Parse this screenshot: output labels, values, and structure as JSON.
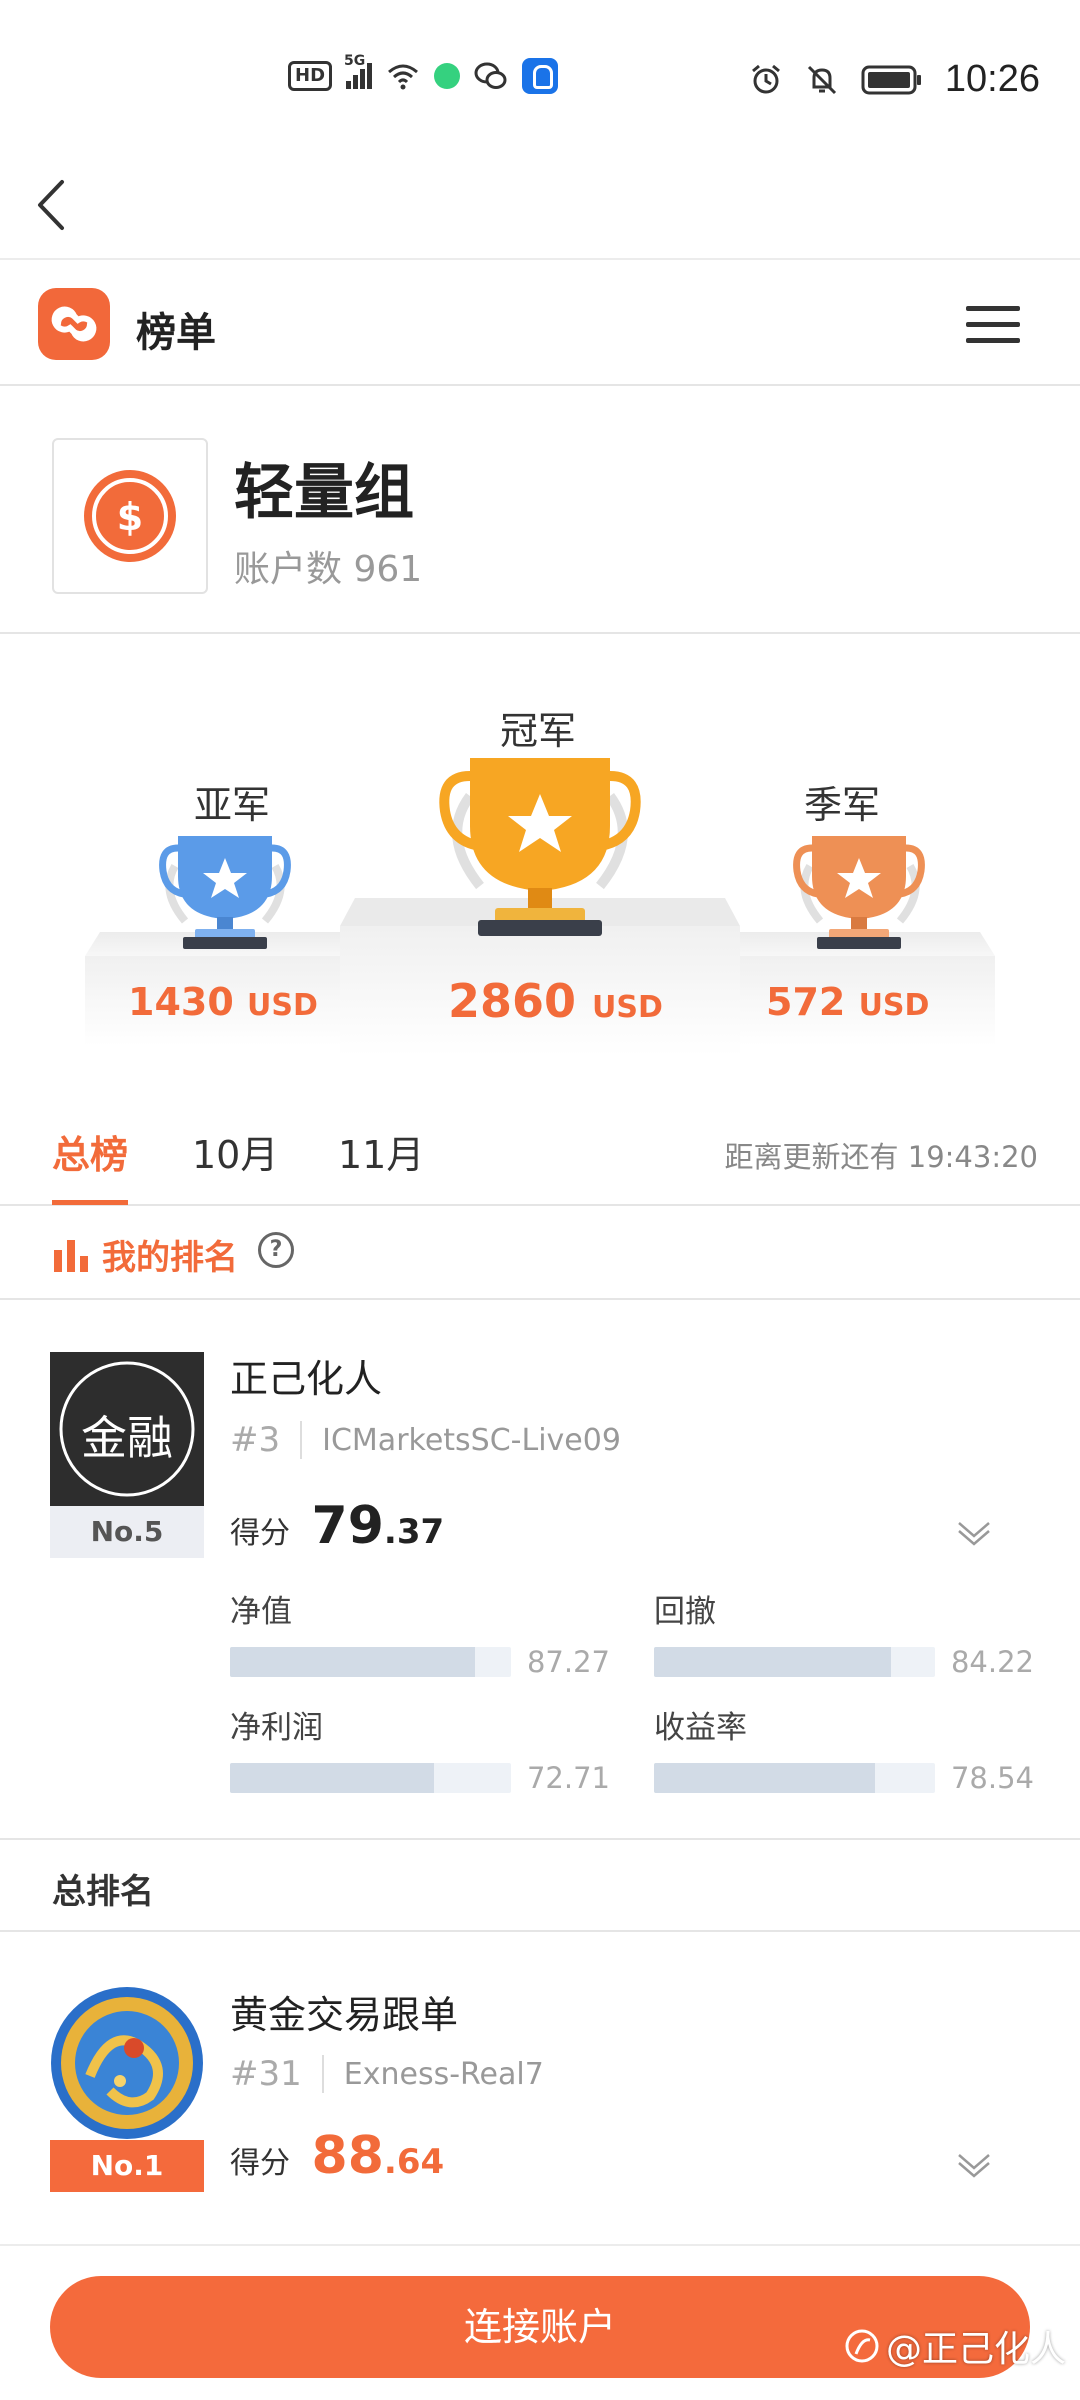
{
  "status_bar": {
    "hd": "HD",
    "signal": "5G",
    "time": "10:26",
    "icons_left": [
      "hd-icon",
      "signal-icon",
      "wifi-icon",
      "chat-bubble-icon",
      "wechat-icon",
      "bulb-app-icon"
    ],
    "icons_right": [
      "alarm-icon",
      "mute-icon",
      "battery-icon"
    ]
  },
  "header": {
    "title": "榜单"
  },
  "group": {
    "name": "轻量组",
    "account_count": "账户数 961"
  },
  "podium": {
    "first": {
      "label": "冠军",
      "amount": "2860",
      "unit": "USD"
    },
    "second": {
      "label": "亚军",
      "amount": "1430",
      "unit": "USD"
    },
    "third": {
      "label": "季军",
      "amount": "572",
      "unit": "USD"
    }
  },
  "tabs": {
    "items": [
      "总榜",
      "10月",
      "11月"
    ],
    "active": 0,
    "countdown": "距离更新还有 19:43:20"
  },
  "my_rank": {
    "title": "我的排名",
    "help": "?",
    "avatar_text": "金融",
    "rank_badge": "No.5",
    "name": "正己化人",
    "position": "#3",
    "server": "ICMarketsSC-Live09",
    "score_label": "得分",
    "score_int": "79",
    "score_dec": ".37",
    "metrics": [
      {
        "label": "净值",
        "value": "87.27",
        "pct": 87.27
      },
      {
        "label": "回撤",
        "value": "84.22",
        "pct": 84.22
      },
      {
        "label": "净利润",
        "value": "72.71",
        "pct": 72.71
      },
      {
        "label": "收益率",
        "value": "78.54",
        "pct": 78.54
      }
    ]
  },
  "total_rank": {
    "title": "总排名",
    "first": {
      "rank_badge": "No.1",
      "name": "黄金交易跟单",
      "position": "#31",
      "server": "Exness-Real7",
      "score_label": "得分",
      "score_int": "88",
      "score_dec": ".64"
    }
  },
  "bottom": {
    "connect_label": "连接账户",
    "watermark": "@正己化人"
  },
  "colors": {
    "accent": "#f26b3a",
    "gold": "#f5a623",
    "silver_blue": "#5b9be8",
    "bronze": "#ee9055"
  }
}
